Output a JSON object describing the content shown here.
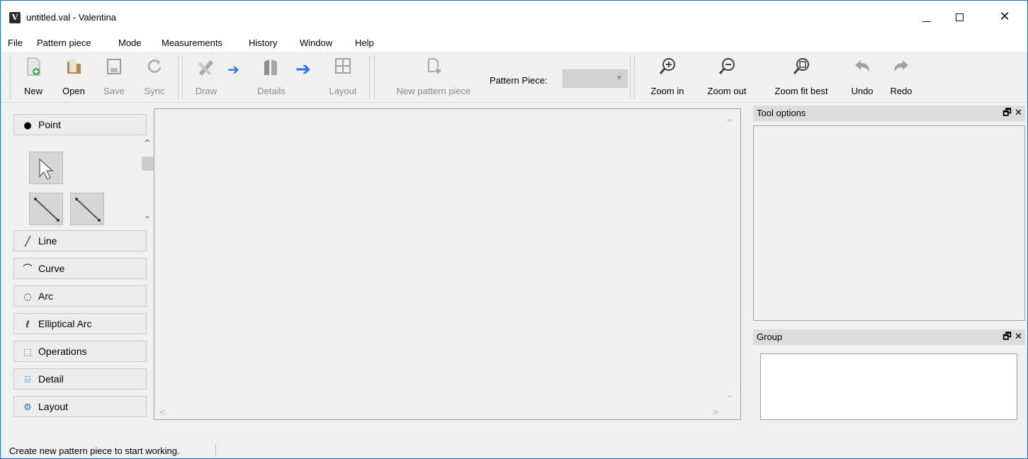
{
  "window": {
    "title": "untitled.val - Valentina",
    "app_icon": "valentina-logo-icon",
    "controls": {
      "minimize": "minimize-icon",
      "maximize": "maximize-icon",
      "close": "close-icon"
    }
  },
  "menubar": {
    "items": [
      "File",
      "Pattern piece",
      "Mode",
      "Measurements",
      "History",
      "Window",
      "Help"
    ]
  },
  "toolbar": {
    "file_tools": [
      {
        "label": "New",
        "icon": "new-file-icon",
        "enabled": true
      },
      {
        "label": "Open",
        "icon": "open-folder-icon",
        "enabled": true
      },
      {
        "label": "Save",
        "icon": "save-icon",
        "enabled": false
      },
      {
        "label": "Sync",
        "icon": "sync-icon",
        "enabled": false
      }
    ],
    "mode_tools": [
      {
        "label": "Draw",
        "icon": "draw-pencil-icon",
        "enabled": false
      },
      {
        "label": "Details",
        "icon": "details-icon",
        "enabled": false
      },
      {
        "label": "Layout",
        "icon": "layout-icon",
        "enabled": false
      }
    ],
    "new_pattern_piece": {
      "label": "New pattern piece",
      "icon": "new-pattern-piece-icon",
      "enabled": false
    },
    "pattern_piece_label": "Pattern Piece:",
    "pattern_piece_value": "",
    "view_tools": [
      {
        "label": "Zoom in",
        "icon": "zoom-in-icon",
        "enabled": true
      },
      {
        "label": "Zoom out",
        "icon": "zoom-out-icon",
        "enabled": true
      },
      {
        "label": "Zoom fit best",
        "icon": "zoom-fit-icon",
        "enabled": true
      },
      {
        "label": "Undo",
        "icon": "undo-icon",
        "enabled": true
      },
      {
        "label": "Redo",
        "icon": "redo-icon",
        "enabled": true
      }
    ]
  },
  "toolbox": {
    "groups": [
      {
        "label": "Point",
        "icon": "point-icon"
      },
      {
        "label": "Line",
        "icon": "line-icon"
      },
      {
        "label": "Curve",
        "icon": "curve-icon"
      },
      {
        "label": "Arc",
        "icon": "arc-icon"
      },
      {
        "label": "Elliptical Arc",
        "icon": "elliptical-arc-icon"
      },
      {
        "label": "Operations",
        "icon": "operations-icon"
      },
      {
        "label": "Detail",
        "icon": "detail-icon"
      },
      {
        "label": "Layout",
        "icon": "layout-gears-icon"
      }
    ],
    "point_tools": [
      "arrow-pointer-icon",
      "segment-line-icon",
      "segment-line-icon"
    ]
  },
  "docks": {
    "tool_options": {
      "title": "Tool options"
    },
    "group": {
      "title": "Group"
    }
  },
  "status": {
    "text": "Create new pattern piece to start working."
  },
  "colors": {
    "accent_blue": "#2f6fe0",
    "window_border": "#1c6fc4",
    "disabled_text": "#8b8b8b"
  }
}
